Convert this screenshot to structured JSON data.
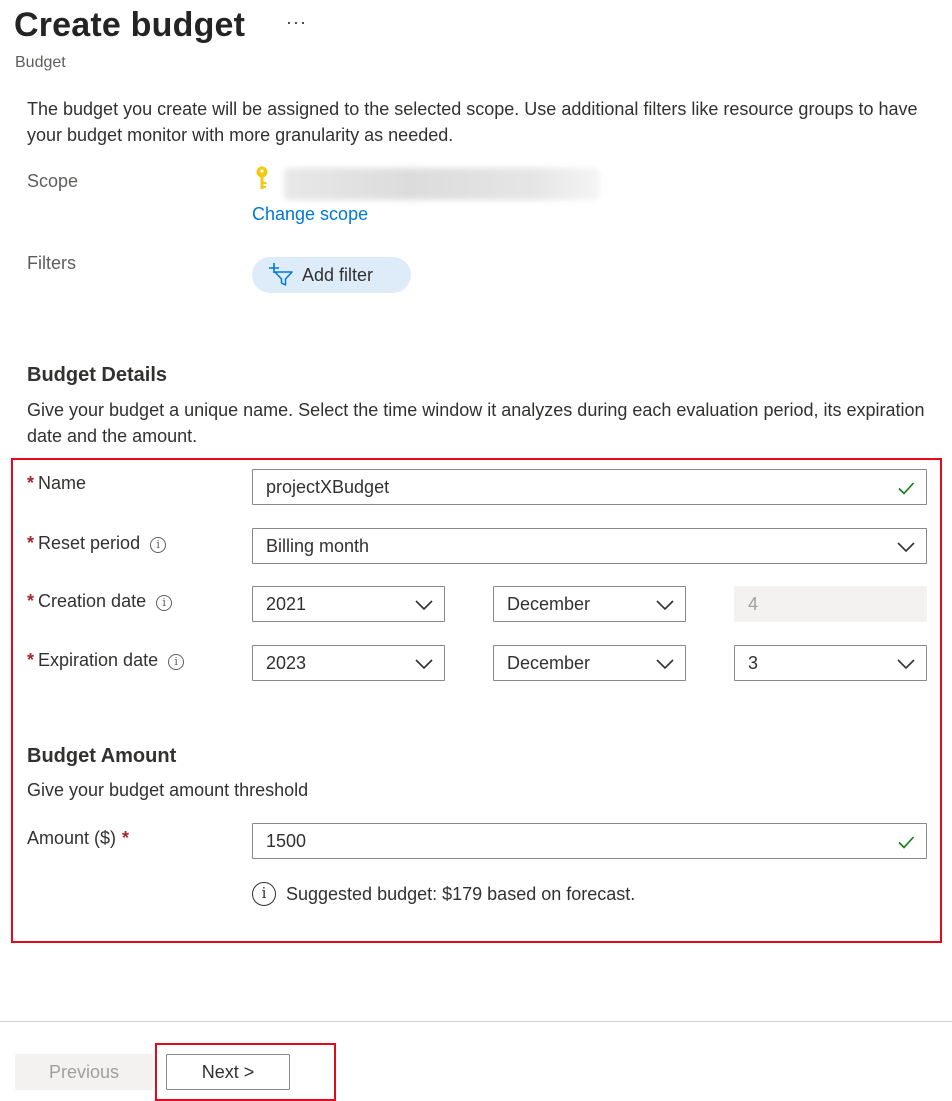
{
  "header": {
    "title": "Create budget",
    "more_label": "···",
    "subtitle": "Budget"
  },
  "intro": "The budget you create will be assigned to the selected scope. Use additional filters like resource groups to have your budget monitor with more granularity as needed.",
  "scope": {
    "label": "Scope",
    "icon": "key-icon",
    "change_link": "Change scope"
  },
  "filters": {
    "label": "Filters",
    "add_button": "Add filter"
  },
  "details": {
    "title": "Budget Details",
    "description": "Give your budget a unique name. Select the time window it analyzes during each evaluation period, its expiration date and the amount.",
    "name": {
      "required": "*",
      "label": "Name",
      "value": "projectXBudget"
    },
    "reset_period": {
      "required": "*",
      "label": "Reset period",
      "info": "i",
      "value": "Billing month"
    },
    "creation_date": {
      "required": "*",
      "label": "Creation date",
      "info": "i",
      "year": "2021",
      "month": "December",
      "day": "4"
    },
    "expiration_date": {
      "required": "*",
      "label": "Expiration date",
      "info": "i",
      "year": "2023",
      "month": "December",
      "day": "3"
    }
  },
  "amount_section": {
    "title": "Budget Amount",
    "description": "Give your budget amount threshold",
    "amount_label": "Amount ($)",
    "required": "*",
    "value": "1500",
    "suggestion_icon": "i",
    "suggestion": "Suggested budget: $179 based on forecast."
  },
  "footer": {
    "previous": "Previous",
    "next": "Next >"
  },
  "colors": {
    "accent": "#0078d4",
    "required": "#a4262c",
    "highlight": "#e00b1c",
    "valid_check": "#107c10",
    "pill_bg": "#deecf9"
  }
}
